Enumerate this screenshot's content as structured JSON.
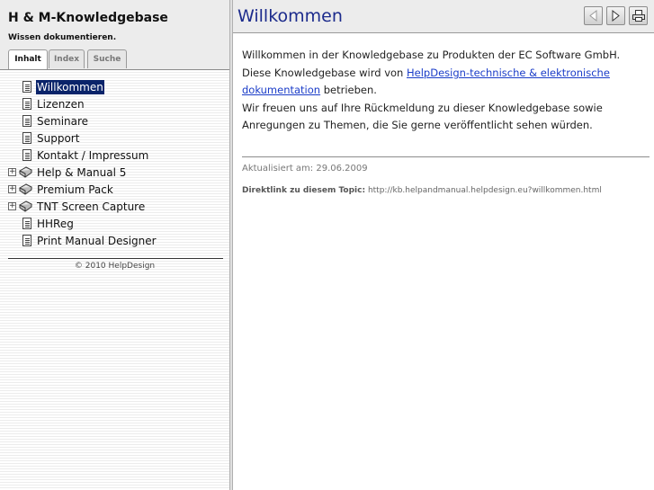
{
  "sidebar": {
    "title": "H & M-Knowledgebase",
    "subtitle": "Wissen dokumentieren.",
    "tabs": [
      {
        "label": "Inhalt"
      },
      {
        "label": "Index"
      },
      {
        "label": "Suche"
      }
    ],
    "toc": [
      {
        "label": "Willkommen",
        "icon": "page-icon",
        "expandable": false,
        "selected": true
      },
      {
        "label": "Lizenzen",
        "icon": "page-icon",
        "expandable": false
      },
      {
        "label": "Seminare",
        "icon": "page-icon",
        "expandable": false
      },
      {
        "label": "Support",
        "icon": "page-icon",
        "expandable": false
      },
      {
        "label": "Kontakt / Impressum",
        "icon": "page-icon",
        "expandable": false
      },
      {
        "label": "Help & Manual 5",
        "icon": "book-icon",
        "expandable": true
      },
      {
        "label": "Premium Pack",
        "icon": "book-icon",
        "expandable": true
      },
      {
        "label": "TNT Screen Capture",
        "icon": "book-icon",
        "expandable": true
      },
      {
        "label": "HHReg",
        "icon": "page-icon",
        "expandable": false
      },
      {
        "label": "Print Manual Designer",
        "icon": "page-icon",
        "expandable": false
      }
    ],
    "copyright": "© 2010 HelpDesign"
  },
  "topic": {
    "title": "Willkommen",
    "buttons": [
      "previous-icon",
      "next-icon",
      "print-icon"
    ],
    "para1": "Willkommen in der Knowledgebase zu Produkten der EC Software GmbH.",
    "para2_before": "Diese Knowledgebase wird von ",
    "para2_link": "HelpDesign-technische & elektronische dokumentation",
    "para2_after": " betrieben.",
    "para3": "Wir freuen uns auf Ihre Rückmeldung zu dieser Knowledgebase sowie Anregungen zu Themen, die Sie gerne veröffentlicht sehen würden.",
    "updated": "Aktualisiert am: 29.06.2009",
    "direct_label": "Direktlink zu diesem Topic:",
    "direct_url": "http://kb.helpandmanual.helpdesign.eu?willkommen.html"
  },
  "colors": {
    "title_blue": "#1c2b8c",
    "link_blue": "#1a3cc8",
    "selection": "#0a246a"
  }
}
